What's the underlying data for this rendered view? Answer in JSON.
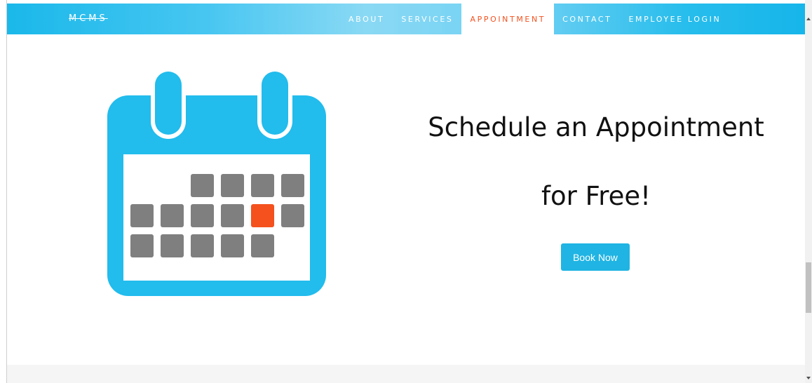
{
  "brand": "MCMS",
  "nav": {
    "items": [
      {
        "label": "ABOUT"
      },
      {
        "label": "SERVICES"
      },
      {
        "label": "APPOINTMENT"
      },
      {
        "label": "CONTACT"
      },
      {
        "label": "EMPLOYEE LOGIN"
      }
    ],
    "active_index": 2
  },
  "hero": {
    "line1": "Schedule an Appointment",
    "line2": "for Free!",
    "button_label": "Book Now"
  },
  "calendar_icon": {
    "name": "calendar-icon",
    "frame_color": "#22bced",
    "day_color": "#7f7f7f",
    "highlight_color": "#f4511e",
    "rows": [
      {
        "blank": 2,
        "days": 4,
        "highlight": -1
      },
      {
        "blank": 0,
        "days": 6,
        "highlight": 4
      },
      {
        "blank": 0,
        "days": 5,
        "highlight": -1
      }
    ]
  },
  "colors": {
    "accent": "#1fb4e3",
    "active_nav": "#f4511e"
  }
}
